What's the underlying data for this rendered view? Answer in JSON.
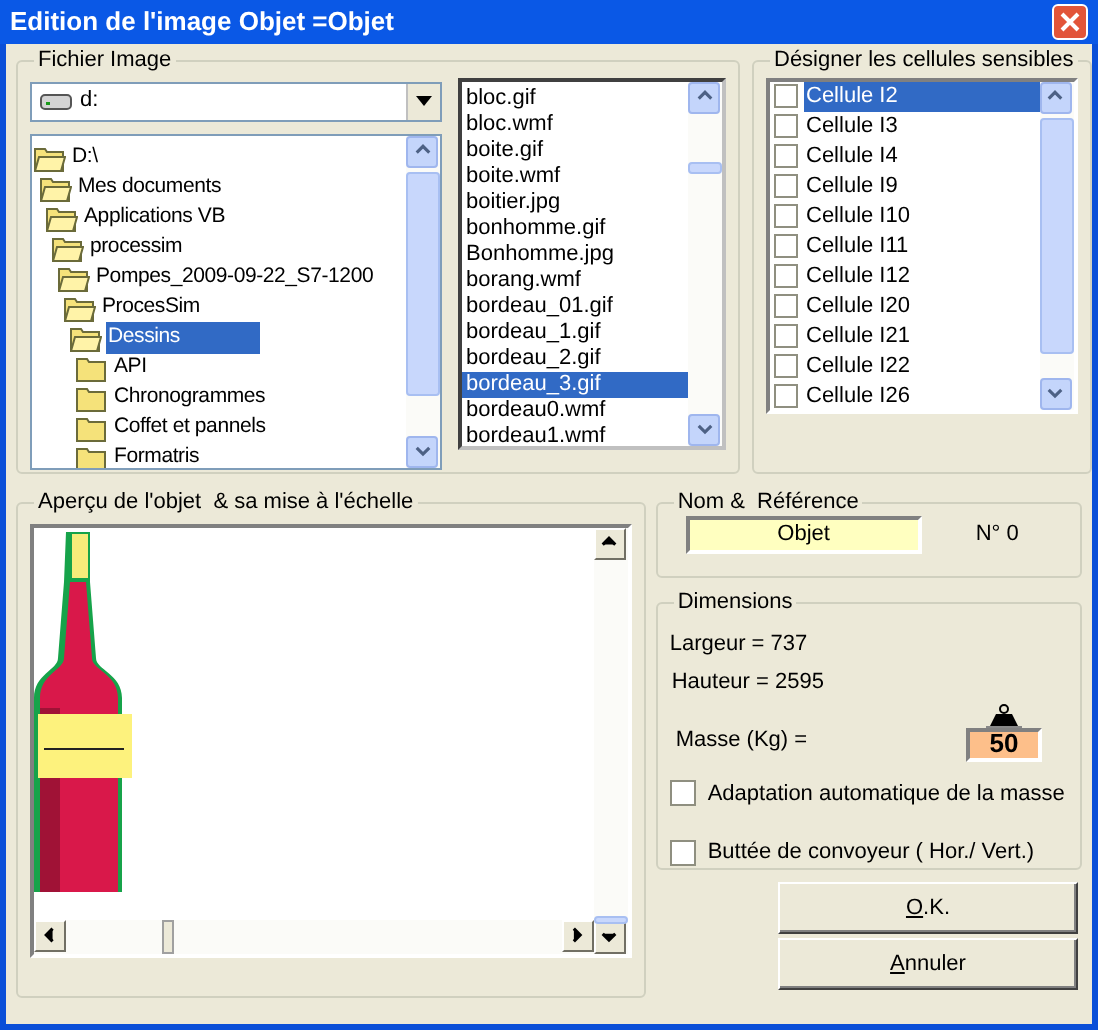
{
  "window": {
    "title": "Edition de l'image Objet =Objet"
  },
  "file_image": {
    "label": "Fichier Image",
    "drive": "d:",
    "folders": [
      {
        "label": "D:\\",
        "expanded": true,
        "selected": false,
        "children": [
          {
            "label": "Mes documents",
            "expanded": true,
            "selected": false,
            "children": [
              {
                "label": "Applications VB",
                "expanded": true,
                "selected": false,
                "children": [
                  {
                    "label": "processim",
                    "expanded": true,
                    "selected": false,
                    "children": [
                      {
                        "label": "Pompes_2009-09-22_S7-1200",
                        "expanded": true,
                        "selected": false,
                        "children": [
                          {
                            "label": "ProcesSim",
                            "expanded": true,
                            "selected": false,
                            "children": [
                              {
                                "label": "Dessins",
                                "expanded": true,
                                "selected": true,
                                "children": [
                                  {
                                    "label": "API",
                                    "expanded": false,
                                    "selected": false
                                  },
                                  {
                                    "label": "Chronogrammes",
                                    "expanded": false,
                                    "selected": false
                                  },
                                  {
                                    "label": "Coffet et pannels",
                                    "expanded": false,
                                    "selected": false
                                  },
                                  {
                                    "label": "Formatris",
                                    "expanded": false,
                                    "selected": false
                                  }
                                ]
                              }
                            ]
                          }
                        ]
                      }
                    ]
                  }
                ]
              }
            ]
          }
        ]
      }
    ],
    "files": [
      {
        "name": "bloc.gif",
        "selected": false
      },
      {
        "name": "bloc.wmf",
        "selected": false
      },
      {
        "name": "boite.gif",
        "selected": false
      },
      {
        "name": "boite.wmf",
        "selected": false
      },
      {
        "name": "boitier.jpg",
        "selected": false
      },
      {
        "name": "bonhomme.gif",
        "selected": false
      },
      {
        "name": "Bonhomme.jpg",
        "selected": false
      },
      {
        "name": "borang.wmf",
        "selected": false
      },
      {
        "name": "bordeau_01.gif",
        "selected": false
      },
      {
        "name": "bordeau_1.gif",
        "selected": false
      },
      {
        "name": "bordeau_2.gif",
        "selected": false
      },
      {
        "name": "bordeau_3.gif",
        "selected": true
      },
      {
        "name": "bordeau0.wmf",
        "selected": false
      },
      {
        "name": "bordeau1.wmf",
        "selected": false
      }
    ]
  },
  "cells": {
    "label": "Désigner les cellules sensibles",
    "items": [
      {
        "label": "Cellule I2",
        "checked": false,
        "selected": true
      },
      {
        "label": "Cellule I3",
        "checked": false,
        "selected": false
      },
      {
        "label": "Cellule I4",
        "checked": false,
        "selected": false
      },
      {
        "label": "Cellule I9",
        "checked": false,
        "selected": false
      },
      {
        "label": "Cellule I10",
        "checked": false,
        "selected": false
      },
      {
        "label": "Cellule I11",
        "checked": false,
        "selected": false
      },
      {
        "label": "Cellule I12",
        "checked": false,
        "selected": false
      },
      {
        "label": "Cellule I20",
        "checked": false,
        "selected": false
      },
      {
        "label": "Cellule I21",
        "checked": false,
        "selected": false
      },
      {
        "label": "Cellule I22",
        "checked": false,
        "selected": false
      },
      {
        "label": "Cellule I26",
        "checked": false,
        "selected": false
      }
    ]
  },
  "preview": {
    "label": "Aperçu de l'objet  & sa mise à l'échelle",
    "kind": "picture"
  },
  "name_reference": {
    "label": "Nom &  Référence",
    "name": "Objet",
    "number": "N° 0"
  },
  "dimensions": {
    "label": "Dimensions",
    "width": "Largeur = 737",
    "height": "Hauteur = 2595",
    "mass_label": "Masse (Kg) =",
    "mass": "50",
    "options": [
      {
        "label": "Adaptation automatique de la masse",
        "checked": false
      },
      {
        "label": "Buttée de convoyeur ( Hor./ Vert.)",
        "checked": false
      }
    ]
  },
  "buttons": [
    "O.K.",
    "Annuler"
  ]
}
